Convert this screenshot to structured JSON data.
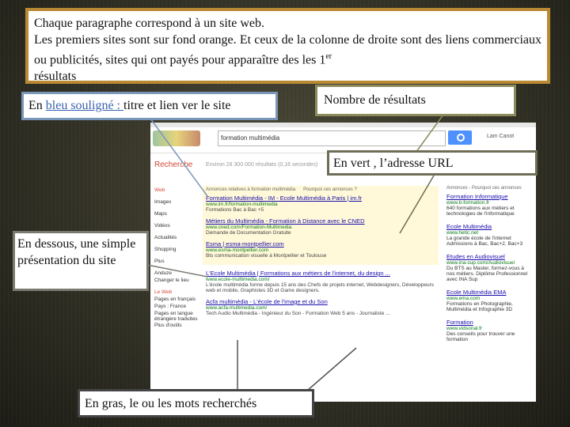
{
  "callouts": {
    "intro_line1": "Chaque paragraphe correspond à un site web.",
    "intro_line2": "Les premiers sites sont sur fond orange. Et ceux de la colonne de droite sont des liens commerciaux ou publicités, sites qui ont payés pour  apparaître des les 1",
    "intro_sup": "er",
    "intro_line3": "résultats",
    "blue_prefix": "En ",
    "blue_underlined": "bleu souligné : ",
    "blue_suffix": "titre et lien ver le site",
    "count": "Nombre de résultats",
    "green": "En vert , l’adresse URL",
    "under": "En dessous, une simple présentation du site",
    "bold": "En gras, le ou les mots recherchés"
  },
  "screenshot": {
    "search_value": "formation multimédia",
    "user": "Lam Canot",
    "recherche": "Recherche",
    "result_count": "Environ 28 300 000 résultats (0,16 secondes)",
    "nav": [
      "Web",
      "Images",
      "Maps",
      "Vidéos",
      "Actualités",
      "Shopping",
      "Plus"
    ],
    "nav2": [
      "Anduze",
      "Changer le lieu"
    ],
    "nav3": [
      "Le Web",
      "Pages en français",
      "Pays : France",
      "Pages en langue étrangère traduites",
      "Plus d'outils"
    ],
    "ads_header": "Annonces relatives à formation multimédia",
    "ads_why": "Pourquoi ces annonces ?",
    "results": [
      {
        "title": "Formation Multimédia - IM - Ecole Multimédia à Paris | im.fr",
        "url": "www.im.fr/formation-multimedia",
        "desc": "Formations Bac à Bac +5"
      },
      {
        "title": "Métiers du Multimédia - Formation à Distance avec le CNED",
        "url": "www.cned.com/Formation-Multimedia",
        "desc": "Demande de Documentation Gratuite"
      },
      {
        "title": "Esma | esma-montpellier.com",
        "url": "www.esma-montpellier.com",
        "desc": "Bts communication visuelle à Montpellier et Toulouse"
      },
      {
        "title": "L'Ecole Multimédia | Formations aux métiers de l'internet, du design ...",
        "url": "www.ecole-multimedia.com/",
        "desc": "L'école multimédia forme depuis 15 ans des Chefs de projets internet, Webdesigners, Développeurs web et mobile, Graphistes 3D et Game designers."
      },
      {
        "title": "Acfa multimédia - L'école de l'image et du Son",
        "url": "www.acfa-multimedia.com/",
        "desc": "Tech Audio Multimédia - Ingénieur du Son - Formation Web 5 ans - Journaliste ..."
      }
    ],
    "right_header": "Annonces - Pourquoi ces annonces",
    "right": [
      {
        "title": "Formation Informatique",
        "url": "www.b-formation.fr",
        "desc": "640 formations aux métiers et technologies de l'informatique"
      },
      {
        "title": "Ecole Multimédia",
        "url": "www.hetic.net",
        "desc": "La grande école de l'internet Admissions à Bac, Bac+2, Bac+3"
      },
      {
        "title": "Etudes en Audiovisuel",
        "url": "www.ina-sup.com/Audiovisuel",
        "desc": "Du BTS au Master, formez-vous à nos métiers. Diplôme Professionnel avec INA Sup"
      },
      {
        "title": "Ecole Multimédia EMA",
        "url": "www.ema.com",
        "desc": "Formations en Photographie, Multimédia et Infographie 3D"
      },
      {
        "title": "Formation",
        "url": "www.vidsonal.fr",
        "desc": "Des conseils pour trouver une formation"
      }
    ]
  },
  "colors": {
    "intro_border": "#b98a33",
    "link": "#1a0dab",
    "url": "#0a7a17",
    "ad_bg": "#fff9d9"
  }
}
